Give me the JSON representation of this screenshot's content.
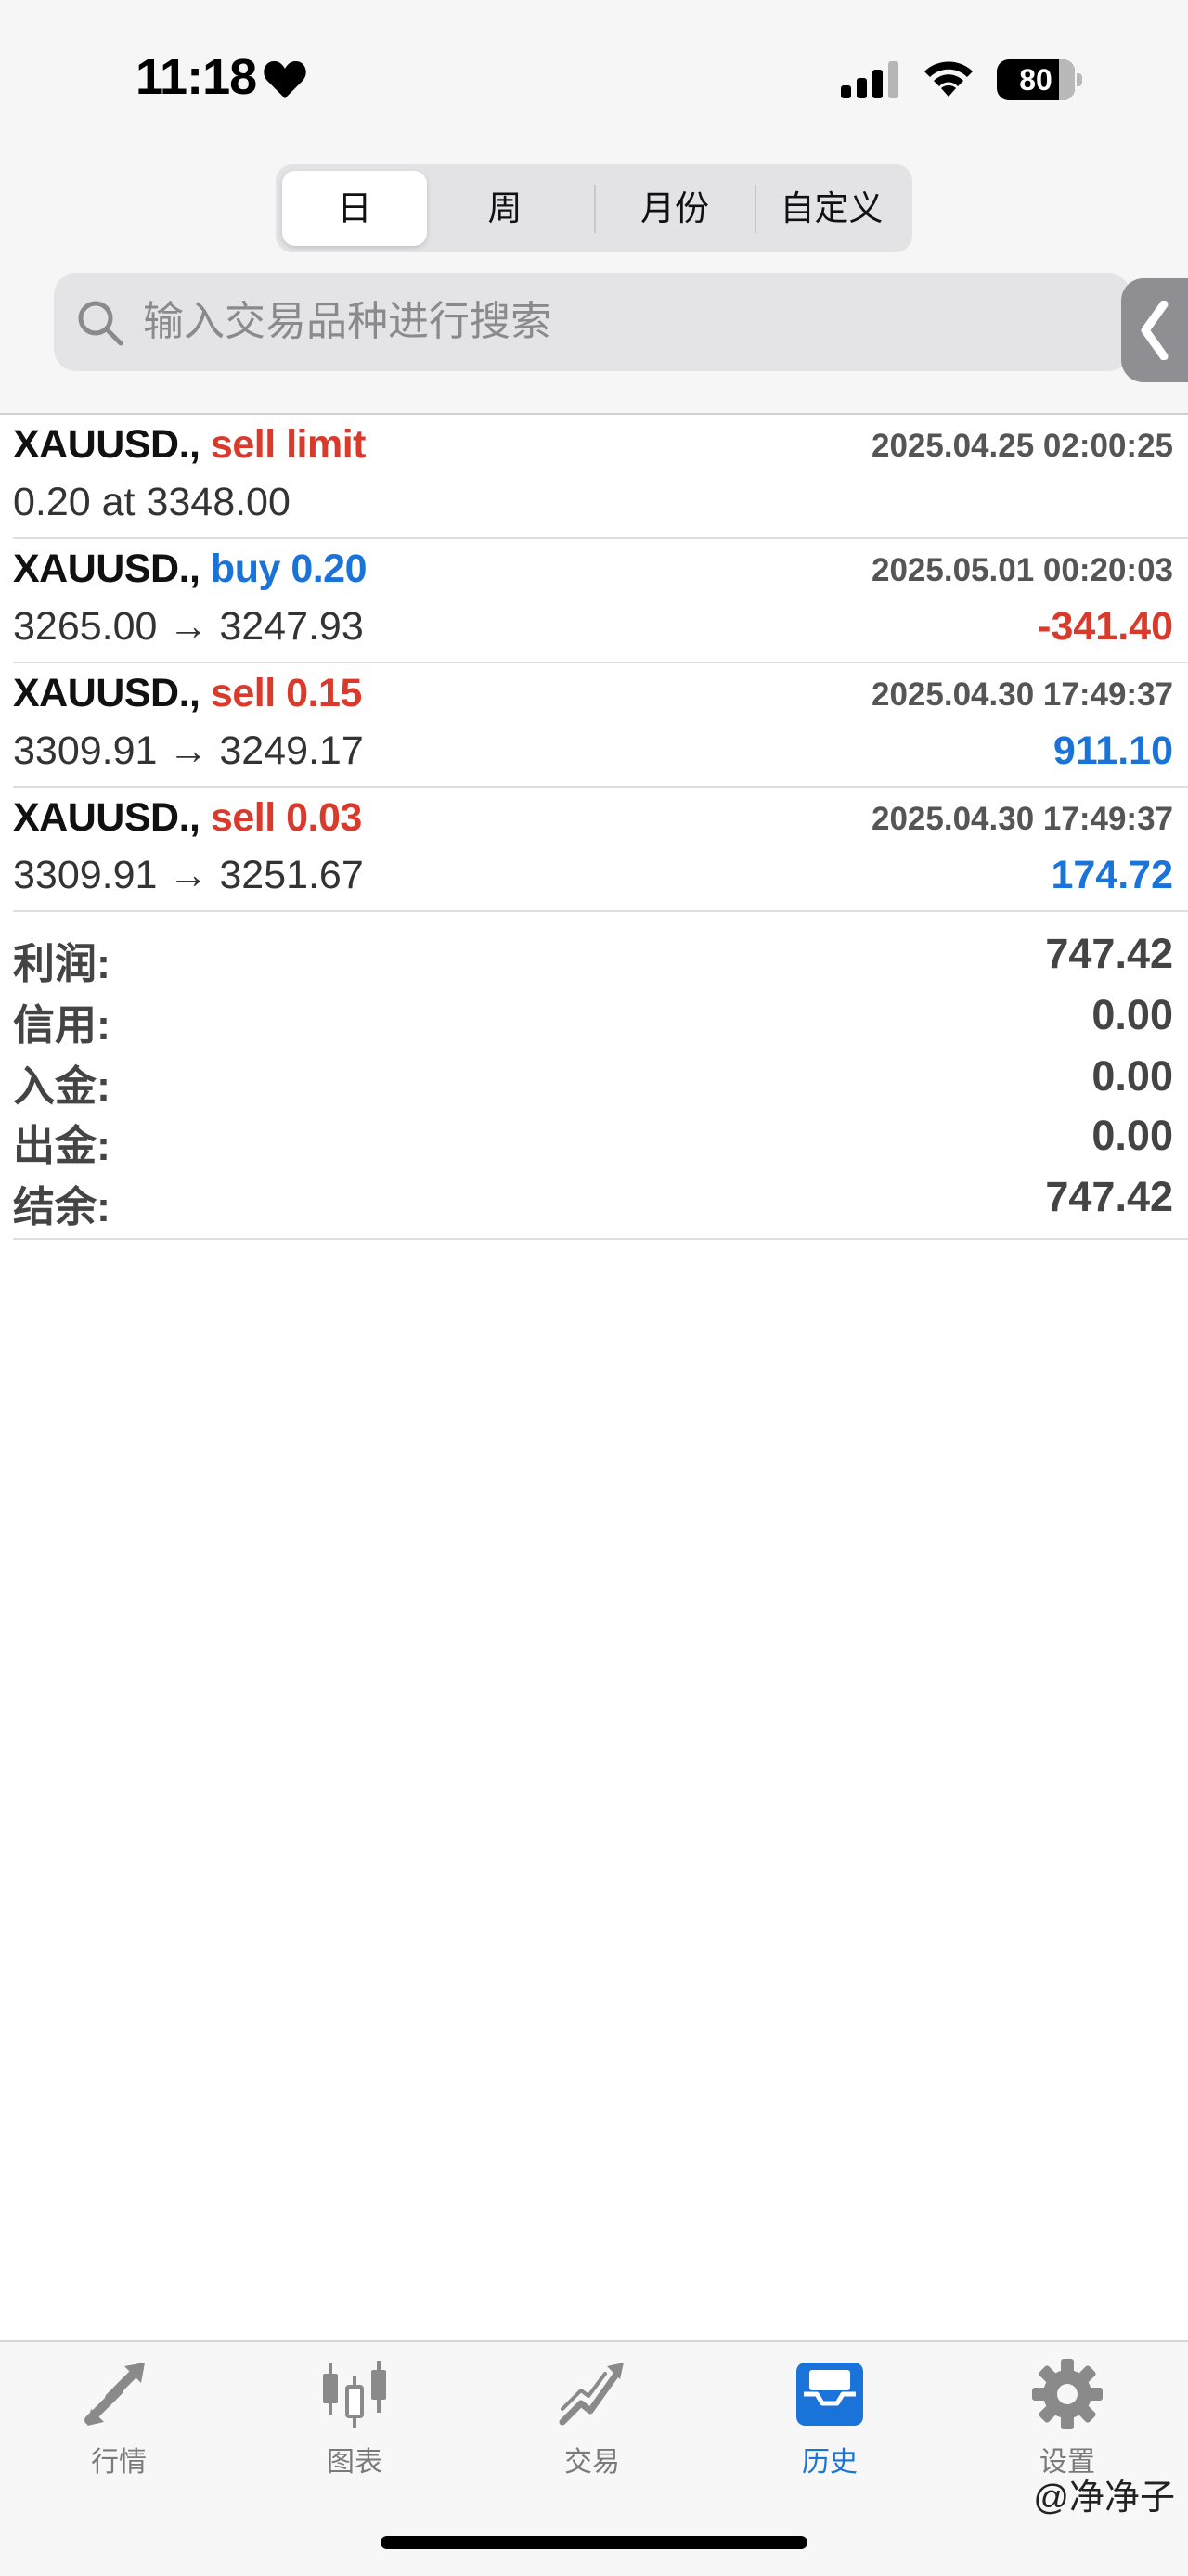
{
  "status_bar": {
    "time": "11:18",
    "battery": "80"
  },
  "period_tabs": [
    {
      "label": "日",
      "active": true
    },
    {
      "label": "周",
      "active": false
    },
    {
      "label": "月份",
      "active": false
    },
    {
      "label": "自定义",
      "active": false
    }
  ],
  "search": {
    "placeholder": "输入交易品种进行搜索",
    "value": ""
  },
  "orders": [
    {
      "symbol": "XAUUSD.,",
      "action": "sell limit",
      "time": "2025.04.25 02:00:25",
      "detail": "0.20 at 3348.00",
      "profit": ""
    },
    {
      "symbol": "XAUUSD.,",
      "action": "buy 0.20",
      "time": "2025.05.01 00:20:03",
      "detail": "3265.00 → 3247.93",
      "profit": "-341.40"
    },
    {
      "symbol": "XAUUSD.,",
      "action": "sell 0.15",
      "time": "2025.04.30 17:49:37",
      "detail": "3309.91 → 3249.17",
      "profit": "911.10"
    },
    {
      "symbol": "XAUUSD.,",
      "action": "sell 0.03",
      "time": "2025.04.30 17:49:37",
      "detail": "3309.91 → 3251.67",
      "profit": "174.72"
    }
  ],
  "summary": [
    {
      "label": "利润:",
      "value": "747.42"
    },
    {
      "label": "信用:",
      "value": "0.00"
    },
    {
      "label": "入金:",
      "value": "0.00"
    },
    {
      "label": "出金:",
      "value": "0.00"
    },
    {
      "label": "结余:",
      "value": "747.42"
    }
  ],
  "tab_bar": [
    {
      "label": "行情",
      "icon": "quotes-arrows-icon",
      "active": false
    },
    {
      "label": "图表",
      "icon": "candlestick-chart-icon",
      "active": false
    },
    {
      "label": "交易",
      "icon": "trade-trend-icon",
      "active": false
    },
    {
      "label": "历史",
      "icon": "history-inbox-icon",
      "active": true
    },
    {
      "label": "设置",
      "icon": "gear-icon",
      "active": false
    }
  ],
  "watermark": "@净净子",
  "colors": {
    "sell": "#d93a2b",
    "buy": "#1a73d8",
    "loss": "#d93a2b",
    "gain": "#1a73d8",
    "active_tab": "#1a73d8",
    "inactive_tab": "#7a7a7a"
  }
}
